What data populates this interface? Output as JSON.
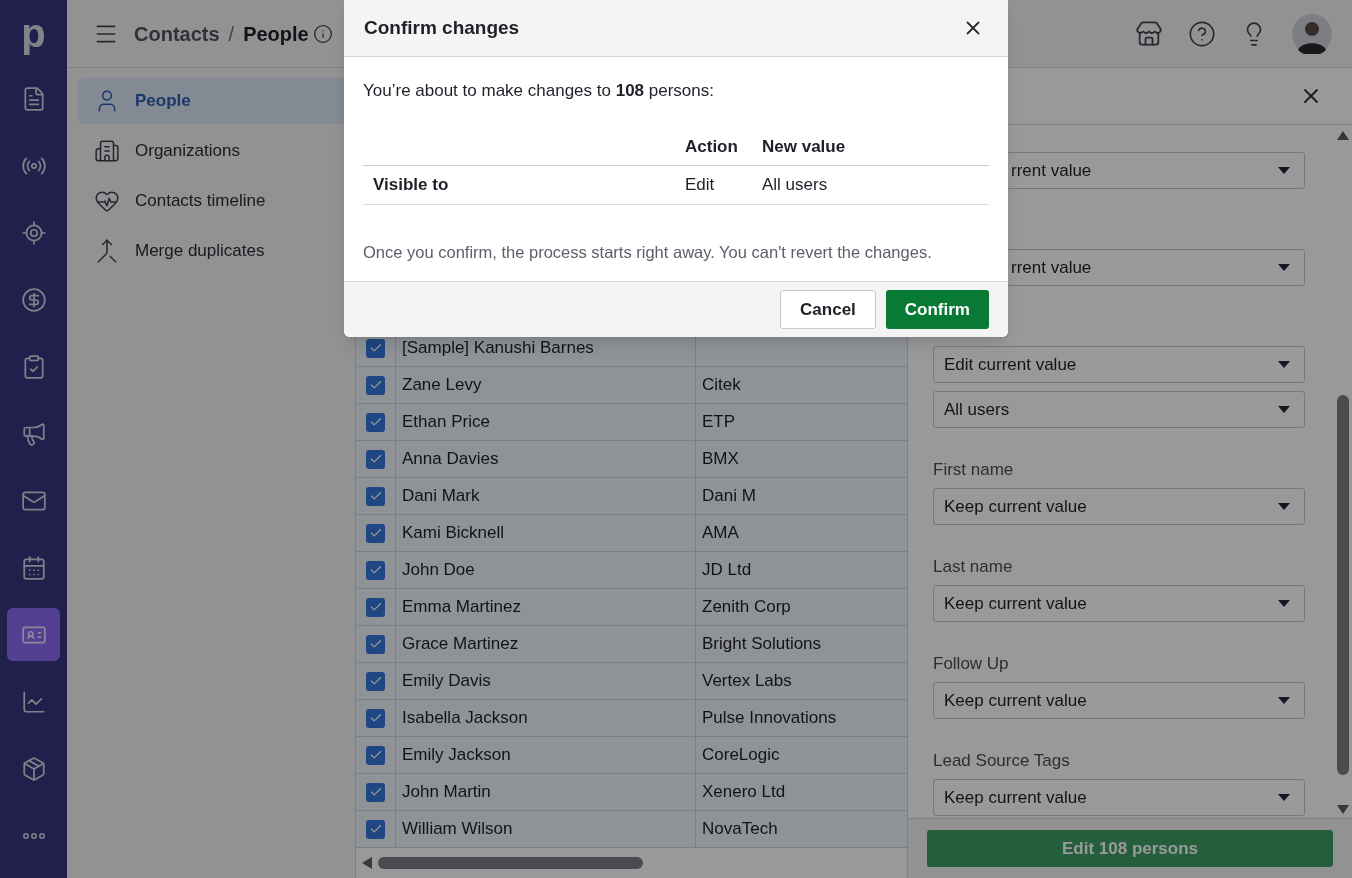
{
  "nav": {
    "logo": "p",
    "items": [
      {
        "kind": "document",
        "selected": false
      },
      {
        "kind": "broadcast",
        "selected": false
      },
      {
        "kind": "target",
        "selected": false
      },
      {
        "kind": "dollar",
        "selected": false
      },
      {
        "kind": "clipboard",
        "selected": false
      },
      {
        "kind": "megaphone",
        "selected": false
      },
      {
        "kind": "mail",
        "selected": false
      },
      {
        "kind": "calendar",
        "selected": false
      },
      {
        "kind": "contact",
        "selected": true
      },
      {
        "kind": "chart",
        "selected": false
      },
      {
        "kind": "box",
        "selected": false
      },
      {
        "kind": "more",
        "selected": false
      }
    ]
  },
  "header": {
    "breadcrumb_parent": "Contacts",
    "breadcrumb_separator": "/",
    "breadcrumb_current": "People"
  },
  "subnav": [
    {
      "kind": "person",
      "label": "People",
      "selected": true
    },
    {
      "kind": "building",
      "label": "Organizations",
      "selected": false
    },
    {
      "kind": "heart",
      "label": "Contacts timeline",
      "selected": false
    },
    {
      "kind": "merge",
      "label": "Merge duplicates",
      "selected": false
    }
  ],
  "table": {
    "rows": [
      {
        "checked": true,
        "name": "[Sample] Kanushi Barnes"
      },
      {
        "checked": true,
        "name": "Zane Levy",
        "column_2": "Citek"
      },
      {
        "checked": true,
        "name": "Ethan Price",
        "column_2": "ETP"
      },
      {
        "checked": true,
        "name": "Anna Davies",
        "column_2": "BMX"
      },
      {
        "checked": true,
        "name": "Dani Mark",
        "column_2": "Dani M"
      },
      {
        "checked": true,
        "name": "Kami Bicknell",
        "column_2": "AMA"
      },
      {
        "checked": true,
        "name": "John Doe",
        "column_2": "JD Ltd"
      },
      {
        "checked": true,
        "name": "Emma Martinez",
        "column_2": "Zenith Corp"
      },
      {
        "checked": true,
        "name": "Grace Martinez",
        "column_2": "Bright Solutions"
      },
      {
        "checked": true,
        "name": "Emily Davis",
        "column_2": "Vertex Labs"
      },
      {
        "checked": true,
        "name": "Isabella Jackson",
        "column_2": "Pulse Innovations"
      },
      {
        "checked": true,
        "name": "Emily Jackson",
        "column_2": "CoreLogic"
      },
      {
        "checked": true,
        "name": "John Martin",
        "column_2": "Xenero Ltd"
      },
      {
        "checked": true,
        "name": "William Wilson",
        "column_2": "NovaTech"
      }
    ]
  },
  "panel": {
    "groups": [
      {
        "selects": [
          {
            "kind": "covered",
            "value": "rrent value"
          }
        ]
      },
      {
        "selects": [
          {
            "kind": "covered",
            "value": "rrent value"
          }
        ]
      },
      {
        "selects": [
          {
            "kind": "full",
            "value": "Edit current value"
          },
          {
            "kind": "full",
            "value": "All users"
          }
        ]
      },
      {
        "label": "First name",
        "selects": [
          {
            "kind": "full",
            "value": "Keep current value"
          }
        ]
      },
      {
        "label": "Last name",
        "selects": [
          {
            "kind": "full",
            "value": "Keep current value"
          }
        ]
      },
      {
        "label": "Follow Up",
        "selects": [
          {
            "kind": "full",
            "value": "Keep current value"
          }
        ]
      },
      {
        "label": "Lead Source Tags",
        "selects": [
          {
            "kind": "full",
            "value": "Keep current value"
          }
        ]
      }
    ],
    "submit": "Edit 108 persons"
  },
  "modal": {
    "title": "Confirm changes",
    "intro": "You’re about to make changes to **108** persons:",
    "columns": [
      "Action",
      "New value"
    ],
    "rows": [
      {
        "field": "Visible to",
        "action": "Edit",
        "new_value": "All users"
      }
    ],
    "note": "Once you confirm, the process starts right away. You can't revert the changes.",
    "buttons": [
      {
        "kind": "secondary",
        "label": "Cancel"
      },
      {
        "kind": "primary",
        "label": "Confirm"
      }
    ]
  }
}
